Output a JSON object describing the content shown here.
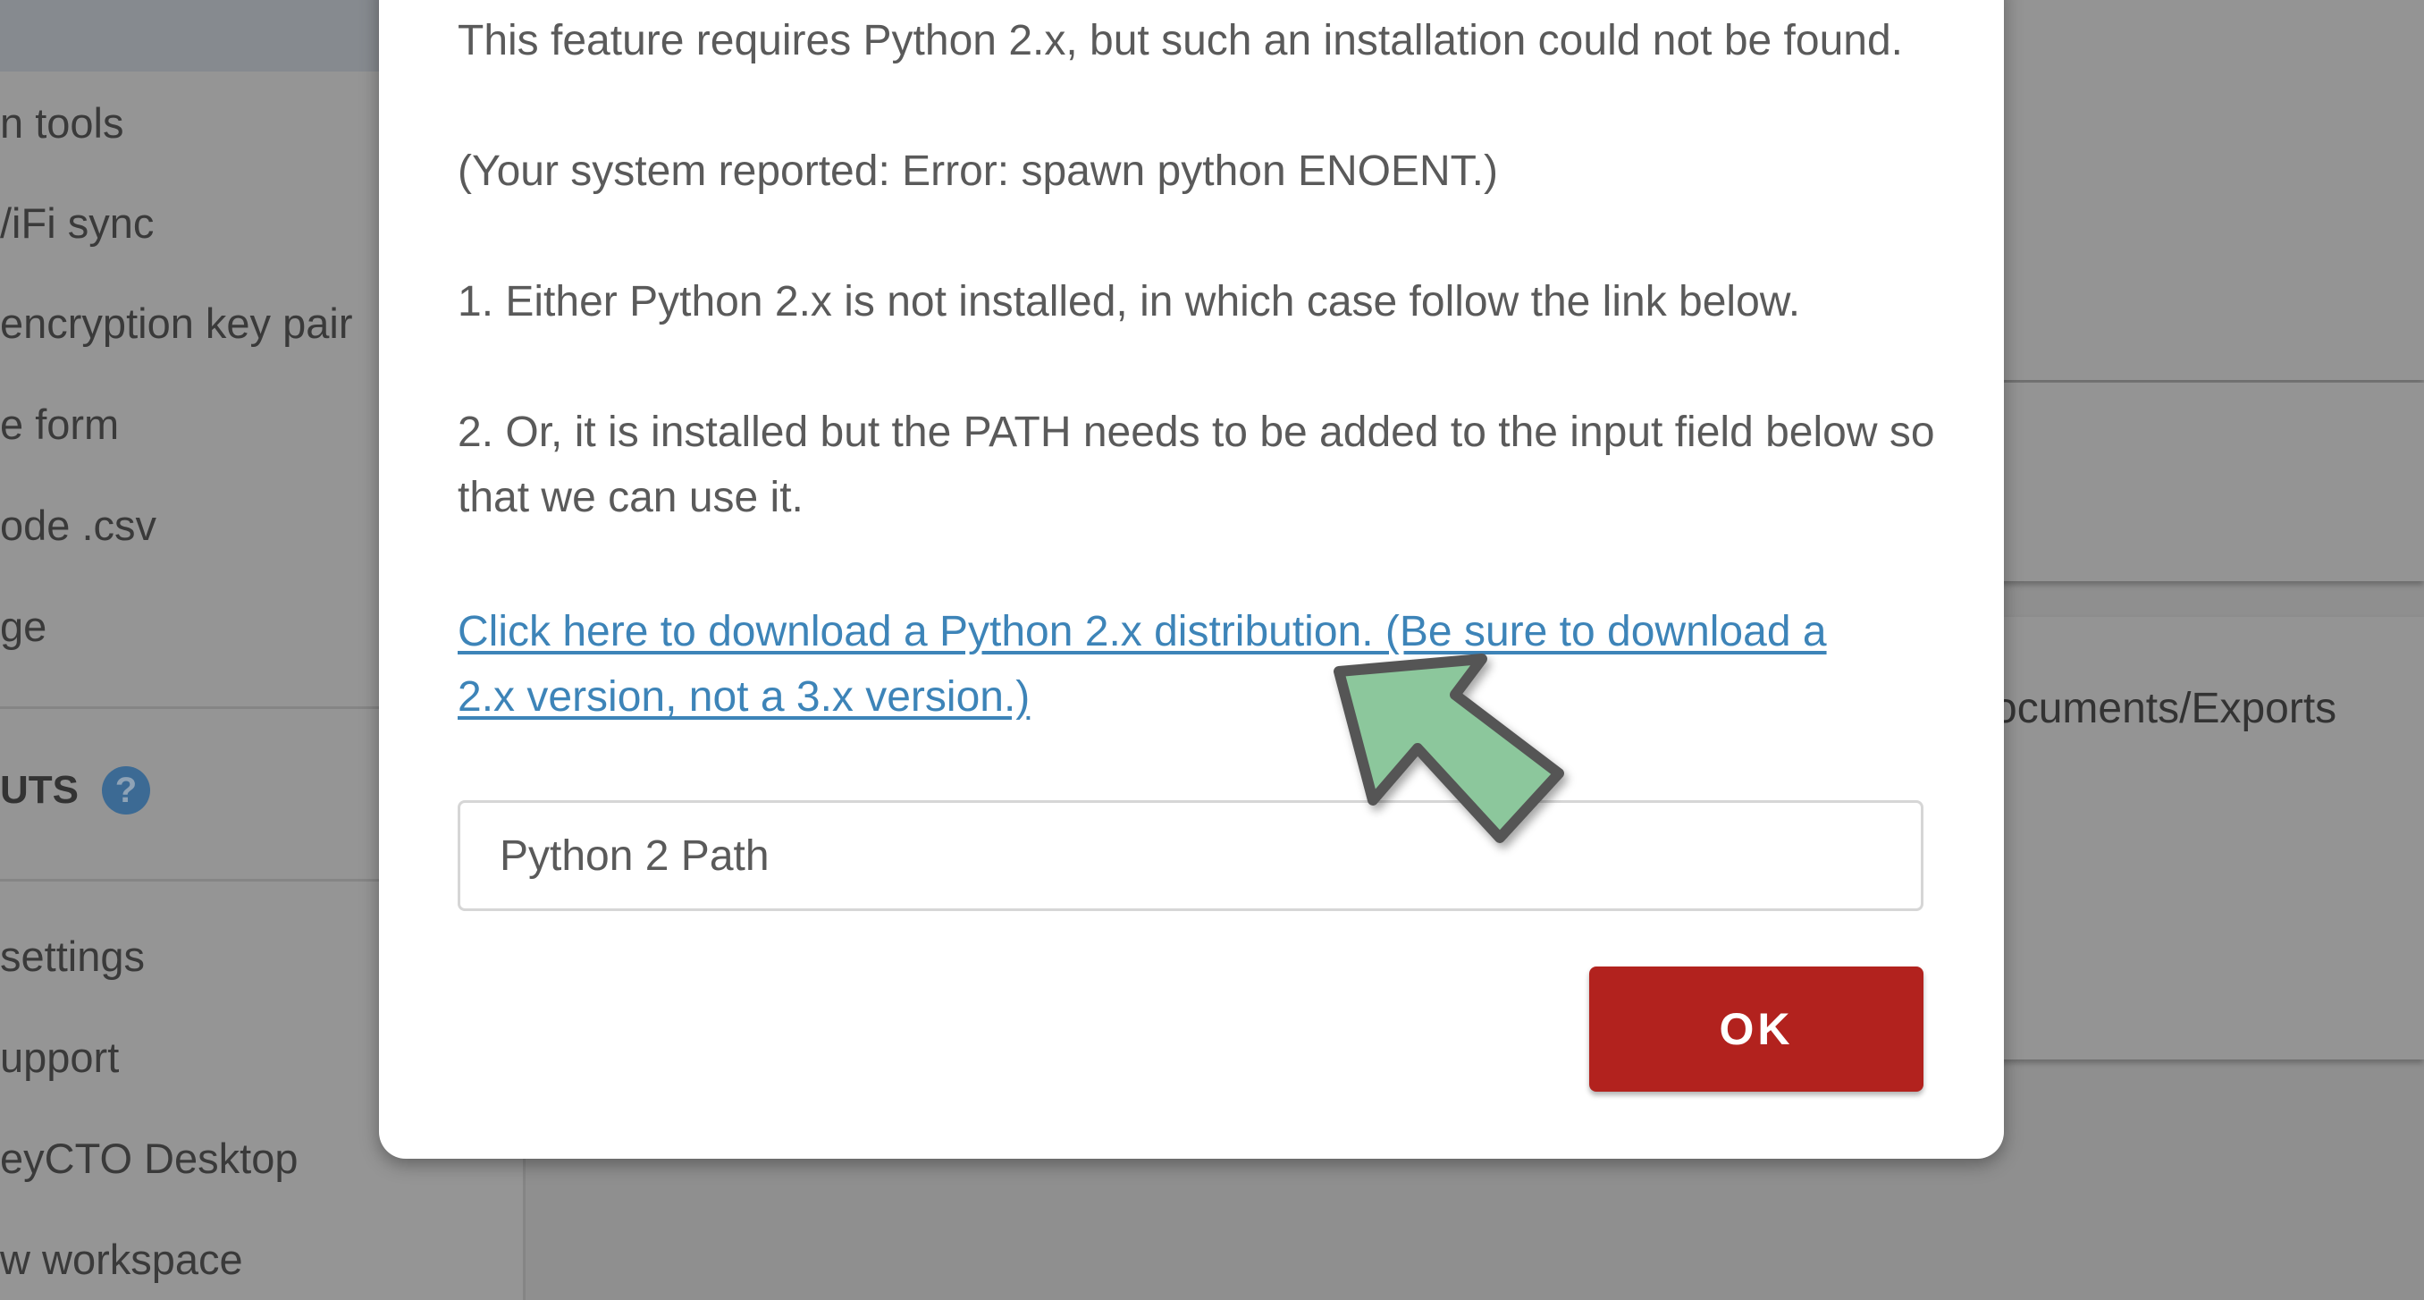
{
  "sidebar": {
    "items": [
      {
        "label": "n tools"
      },
      {
        "label": "/iFi sync"
      },
      {
        "label": "encryption key pair"
      },
      {
        "label": "e form"
      },
      {
        "label": "ode .csv"
      },
      {
        "label": "ge"
      }
    ],
    "section_header": "UTS",
    "help_icon": "?",
    "bottom_items": [
      {
        "label": " settings"
      },
      {
        "label": "upport"
      },
      {
        "label": "eyCTO Desktop"
      },
      {
        "label": "w workspace"
      }
    ]
  },
  "main": {
    "export_path_text": "ocuments/Exports"
  },
  "dialog": {
    "line1": "This feature requires Python 2.x, but such an installation could not be found.",
    "line2": "(Your system reported: Error: spawn python ENOENT.)",
    "step1": "1. Either Python 2.x is not installed, in which case follow the link below.",
    "step2": "2. Or, it is installed but the PATH needs to be added to the input field below so that we can use it.",
    "download_link": "Click here to download a Python 2.x distribution. (Be sure to download a 2.x version, not a 3.x version.)",
    "path_input": {
      "placeholder": "Python 2 Path",
      "value": ""
    },
    "ok_label": "OK"
  },
  "colors": {
    "ok_button": "#b2221e",
    "link": "#3d84b8",
    "arrow_fill": "#8cc79c",
    "arrow_stroke": "#555555"
  },
  "icons": {
    "annotation": "pointer-arrow-icon",
    "help": "help-circle-icon"
  }
}
